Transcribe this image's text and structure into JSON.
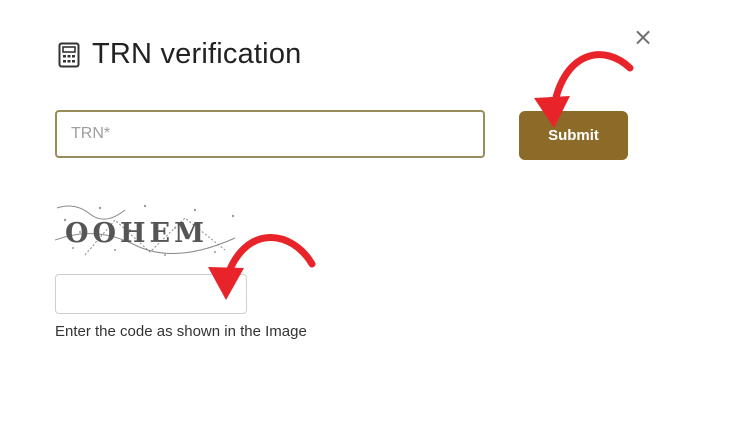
{
  "dialog": {
    "title": "TRN verification",
    "close_label": "×",
    "icon": "calculator-icon"
  },
  "trn": {
    "placeholder": "TRN*",
    "value": ""
  },
  "submit": {
    "label": "Submit"
  },
  "captcha": {
    "code": "OOHEM",
    "input_value": "",
    "hint": "Enter the code as shown in the Image"
  },
  "colors": {
    "accent": "#8c6a28",
    "input_border": "#9a8b5b",
    "annotation_arrow": "#e8242a"
  }
}
